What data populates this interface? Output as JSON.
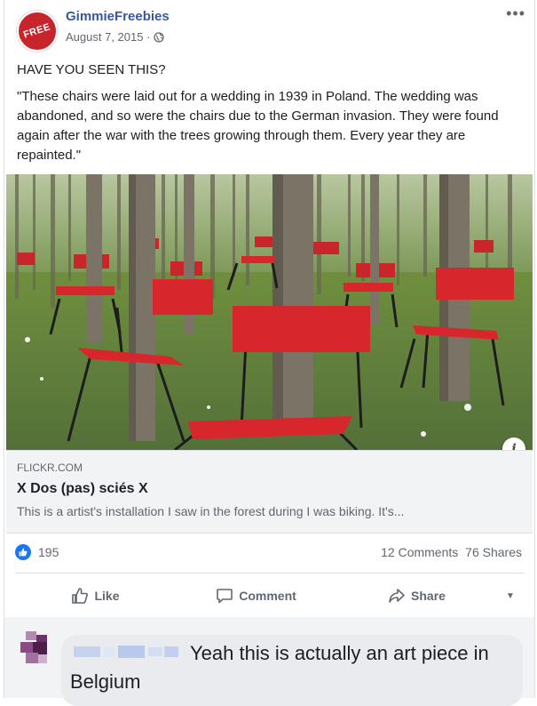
{
  "post": {
    "page_name": "GimmieFreebies",
    "avatar_text": "FREE",
    "date": "August 7, 2015 ·",
    "more": "•••",
    "headline": "HAVE YOU SEEN THIS?",
    "quote": "\"These chairs were laid out for a wedding in 1939 in Poland. The wedding was abandoned, and so were the chairs due to the German invasion. They were found again after the war with the trees growing through them. Every year they are repainted.\""
  },
  "link": {
    "domain": "FLICKR.COM",
    "title": "X Dos (pas) sciés X",
    "description": "This is a artist's installation I saw in the forest during I was biking. It's..."
  },
  "info_icon": "i",
  "reactions": {
    "like_count": "195",
    "comments": "12 Comments",
    "shares": "76 Shares"
  },
  "actions": {
    "like": "Like",
    "comment": "Comment",
    "share": "Share"
  },
  "comment": {
    "text": "Yeah this is actually an art piece in Belgium"
  },
  "colors": {
    "brand_blue": "#385898",
    "like_blue": "#1877f2",
    "chair_red": "#d7262c"
  }
}
